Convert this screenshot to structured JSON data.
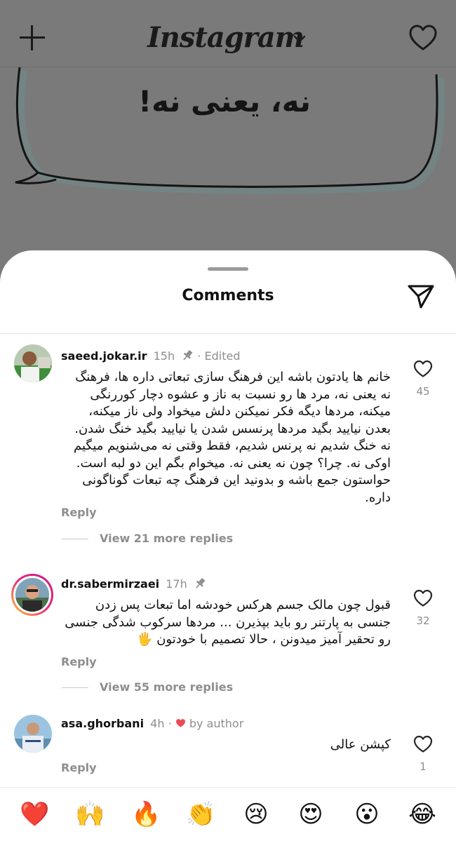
{
  "header": {
    "brand": "Instagram",
    "icons": [
      "plus-icon",
      "chevron-down-icon",
      "heart-icon"
    ]
  },
  "post": {
    "text": "نه، یعنی نه!"
  },
  "sheet": {
    "title": "Comments",
    "send_icon": "send-icon"
  },
  "comments": [
    {
      "username": "saeed.jokar.ir",
      "time": "15h",
      "pinned": true,
      "edited": "· Edited",
      "text": "خانم ها یادتون باشه این فرهنگ سازی تبعاتی داره ها، فرهنگ نه یعنی نه، مرد ها رو نسبت به ناز و عشوه دچار کوررنگی میکنه، مردها دیگه فکر نمیکنن دلش میخواد ولی ناز میکنه، بعدن نیایید بگید مردها پرنسس شدن یا نیایید بگید خنگ شدن. نه خنگ شدیم نه پرنس شدیم، فقط وقتی نه می‌شنویم میگیم اوکی نه. چرا؟ چون نه یعنی نه. میخوام بگم این دو لبه است. حواستون جمع باشه و بدونید این فرهنگ چه تبعات گوناگونی داره.",
      "reply": "Reply",
      "likes": "45",
      "more_replies": "View 21 more replies"
    },
    {
      "username": "dr.sabermirzaei",
      "time": "17h",
      "pinned": true,
      "text": "قبول چون مالک جسم هرکس خودشه اما تبعات پس زدن جنسی به پارتنر رو باید بپذیرن ... مردها سرکوب شدگی جنسی رو تحقیر آمیز میدونن ، حالا تصمیم با خودتون 🖐",
      "reply": "Reply",
      "likes": "32",
      "more_replies": "View 55 more replies"
    },
    {
      "username": "asa.ghorbani",
      "time": "4h",
      "by_author": "by author",
      "text": "کپشن عالی",
      "reply": "Reply",
      "likes": "1"
    }
  ],
  "emoji_bar": [
    "❤️",
    "🙌",
    "🔥",
    "👏",
    "😢",
    "😍",
    "😮",
    "😂"
  ],
  "colors": {
    "overlay": "#7a7a7a",
    "secondary_text": "#8e8e8e",
    "author_heart": "#ed4956",
    "story_ring_start": "#f9ce34",
    "story_ring_end": "#c0188c"
  }
}
